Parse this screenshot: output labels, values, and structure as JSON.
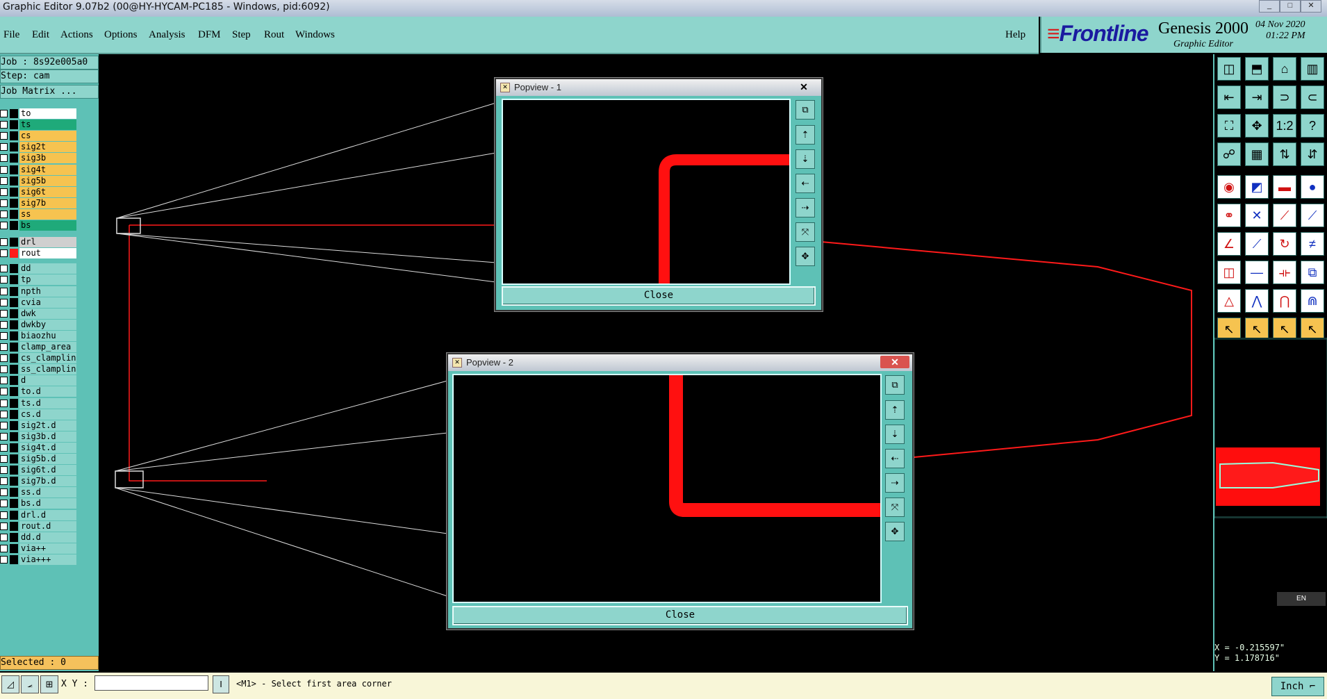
{
  "window": {
    "title": "Graphic Editor 9.07b2 (00@HY-HYCAM-PC185 - Windows, pid:6092)",
    "min": "_",
    "max": "□",
    "close": "✕"
  },
  "menu": [
    "File",
    "Edit",
    "Actions",
    "Options",
    "Analysis",
    "DFM",
    "Step",
    "Rout",
    "Windows"
  ],
  "help": "Help",
  "brand": {
    "logo": "Frontline",
    "product": "Genesis 2000",
    "subtitle": "Graphic Editor",
    "date": "04 Nov 2020",
    "time": "01:22 PM"
  },
  "job": {
    "job_label": "Job : 8s92e005a0",
    "step_label": "Step: cam",
    "matrix_button": "Job Matrix ..."
  },
  "layers": [
    {
      "name": "to",
      "color": "#ffffff"
    },
    {
      "name": "ts",
      "color": "#1faa7a"
    },
    {
      "name": "cs",
      "color": "#f6c350"
    },
    {
      "name": "sig2t",
      "color": "#f6c350"
    },
    {
      "name": "sig3b",
      "color": "#f6c350"
    },
    {
      "name": "sig4t",
      "color": "#f6c350"
    },
    {
      "name": "sig5b",
      "color": "#f6c350"
    },
    {
      "name": "sig6t",
      "color": "#f6c350"
    },
    {
      "name": "sig7b",
      "color": "#f6c350"
    },
    {
      "name": "ss",
      "color": "#f6c350"
    },
    {
      "name": "bs",
      "color": "#1faa7a"
    },
    {
      "name": "drl",
      "color": "#cfcfcf"
    },
    {
      "name": "rout",
      "color": "#ffffff"
    },
    {
      "name": "dd",
      "color": "#8ed5cc"
    },
    {
      "name": "tp",
      "color": "#8ed5cc"
    },
    {
      "name": "npth",
      "color": "#8ed5cc"
    },
    {
      "name": "cvia",
      "color": "#8ed5cc"
    },
    {
      "name": "dwk",
      "color": "#8ed5cc"
    },
    {
      "name": "dwkby",
      "color": "#8ed5cc"
    },
    {
      "name": "biaozhu",
      "color": "#8ed5cc"
    },
    {
      "name": "clamp_area",
      "color": "#8ed5cc"
    },
    {
      "name": "cs_clamplin",
      "color": "#8ed5cc"
    },
    {
      "name": "ss_clamplin",
      "color": "#8ed5cc"
    },
    {
      "name": "d",
      "color": "#8ed5cc"
    },
    {
      "name": "to.d",
      "color": "#8ed5cc"
    },
    {
      "name": "ts.d",
      "color": "#8ed5cc"
    },
    {
      "name": "cs.d",
      "color": "#8ed5cc"
    },
    {
      "name": "sig2t.d",
      "color": "#8ed5cc"
    },
    {
      "name": "sig3b.d",
      "color": "#8ed5cc"
    },
    {
      "name": "sig4t.d",
      "color": "#8ed5cc"
    },
    {
      "name": "sig5b.d",
      "color": "#8ed5cc"
    },
    {
      "name": "sig6t.d",
      "color": "#8ed5cc"
    },
    {
      "name": "sig7b.d",
      "color": "#8ed5cc"
    },
    {
      "name": "ss.d",
      "color": "#8ed5cc"
    },
    {
      "name": "bs.d",
      "color": "#8ed5cc"
    },
    {
      "name": "drl.d",
      "color": "#8ed5cc"
    },
    {
      "name": "rout.d",
      "color": "#8ed5cc"
    },
    {
      "name": "dd.d",
      "color": "#8ed5cc"
    },
    {
      "name": "via++",
      "color": "#8ed5cc"
    },
    {
      "name": "via+++",
      "color": "#8ed5cc"
    }
  ],
  "selected": "Selected : 0",
  "popview1": {
    "title": "Popview - 1",
    "close": "Close"
  },
  "popview2": {
    "title": "Popview - 2",
    "close": "Close"
  },
  "status": {
    "xy_label": "X Y :",
    "xy_value": "",
    "message": "<M1> - Select first area corner",
    "units": "Inch"
  },
  "coords": {
    "x": "X = -0.215597\"",
    "y": "Y = 1.178716\""
  },
  "ime": "EN",
  "colors": {
    "panel": "#5ec1b6",
    "menu": "#8ed5cc",
    "trace": "#ff0000",
    "accent": "#f6c350"
  }
}
